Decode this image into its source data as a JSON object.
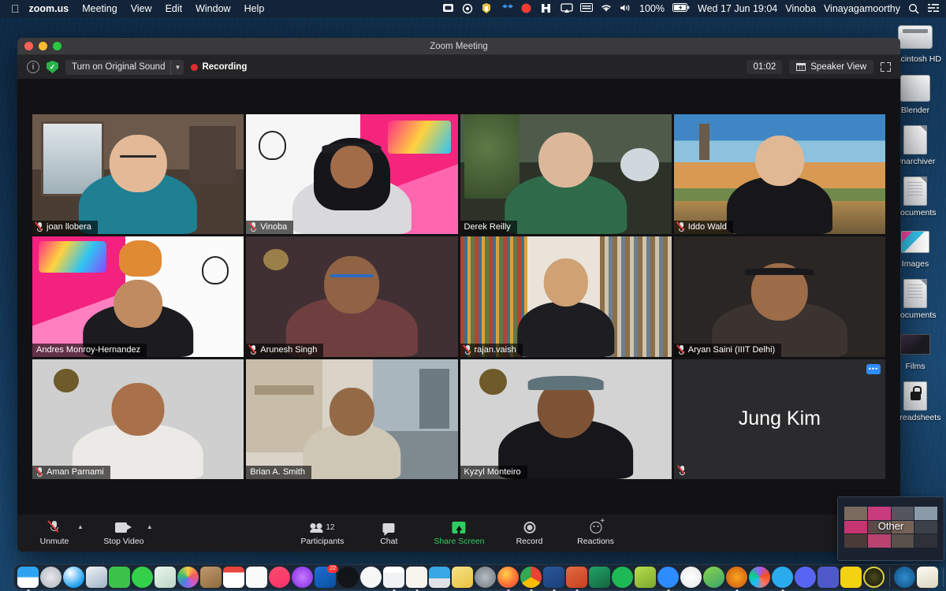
{
  "menubar": {
    "apple_icon": "apple-logo-icon",
    "items": [
      {
        "label": "zoom.us",
        "bold": true
      },
      {
        "label": "Meeting",
        "bold": false
      },
      {
        "label": "View",
        "bold": false
      },
      {
        "label": "Edit",
        "bold": false
      },
      {
        "label": "Window",
        "bold": false
      },
      {
        "label": "Help",
        "bold": false
      }
    ],
    "status_icons": [
      "screen-recording-icon",
      "circle-slash-icon",
      "shield-badge-icon",
      "dropbox-icon",
      "record-red-icon",
      "bartender-icon",
      "airplay-icon",
      "keyboard-icon",
      "wifi-icon",
      "volume-icon"
    ],
    "battery_percent": "100%",
    "battery_icon": "battery-charging-icon",
    "datetime": "Wed 17 Jun  19:04",
    "user_first": "Vinoba",
    "user_last": "Vinayagamoorthy",
    "search_icon": "search-icon",
    "control_center_icon": "control-center-icon"
  },
  "desktop_icons": [
    {
      "label": "Macintosh HD",
      "icon": "hard-drive-icon",
      "shape": "hd"
    },
    {
      "label": "Blender",
      "icon": "blender-folder-icon",
      "shape": "box"
    },
    {
      "label": "Unarchiver",
      "icon": "unarchiver-doc-icon",
      "shape": "doc-plain"
    },
    {
      "label": "Documents",
      "icon": "text-document-icon",
      "shape": "doc-lines"
    },
    {
      "label": "Images",
      "icon": "image-file-icon",
      "shape": "pic"
    },
    {
      "label": "Documents",
      "icon": "documents-stack-icon",
      "shape": "doc-lines"
    },
    {
      "label": "Films",
      "icon": "film-file-icon",
      "shape": "film"
    },
    {
      "label": "Spreadsheets",
      "icon": "locked-spreadsheet-icon",
      "shape": "lock"
    }
  ],
  "window": {
    "title": "Zoom Meeting",
    "traffic_lights": [
      "close-button",
      "minimize-button",
      "maximize-button"
    ],
    "toolbar": {
      "info_icon": "info-icon",
      "encryption_icon": "shield-check-icon",
      "original_sound_label": "Turn on Original Sound",
      "dropdown_icon": "chevron-down-icon",
      "recording_label": "Recording",
      "recording_dot": "record-indicator-icon",
      "timer": "01:02",
      "view_label": "Speaker View",
      "view_icon": "grid-view-icon",
      "fullscreen_icon": "enter-fullscreen-icon"
    }
  },
  "participants": [
    {
      "name": "joan llobera",
      "muted": true,
      "active": false,
      "scene": "room-window",
      "name_visible": true
    },
    {
      "name": "Vinoba",
      "muted": true,
      "active": false,
      "scene": "lmx-slide-mirrored",
      "name_visible": true
    },
    {
      "name": "Derek Reilly",
      "muted": false,
      "active": false,
      "scene": "plant-room",
      "name_visible": true
    },
    {
      "name": "Iddo Wald",
      "muted": true,
      "active": false,
      "scene": "barcelona-sunset",
      "name_visible": true
    },
    {
      "name": "Andres Monroy-Hernandez",
      "muted": false,
      "active": true,
      "scene": "lmx-slide-cat",
      "name_visible": true
    },
    {
      "name": "Arunesh Singh",
      "muted": true,
      "active": false,
      "scene": "weave-bg-dark",
      "name_visible": true
    },
    {
      "name": "rajan.vaish",
      "muted": true,
      "active": false,
      "scene": "bookshelf",
      "name_visible": true
    },
    {
      "name": "Aryan Saini (IIIT Delhi)",
      "muted": true,
      "active": false,
      "scene": "dark-room",
      "name_visible": true
    },
    {
      "name": "Aman Parnami",
      "muted": true,
      "active": false,
      "scene": "weave-bg-light",
      "name_visible": true
    },
    {
      "name": "Brian A. Smith",
      "muted": false,
      "active": false,
      "scene": "office-window",
      "name_visible": true
    },
    {
      "name": "Kyzyl Monteiro",
      "muted": false,
      "active": false,
      "scene": "weave-bg-cap",
      "name_visible": true
    },
    {
      "name": "Jung Kim",
      "muted": true,
      "active": false,
      "scene": "name-only",
      "name_visible": false,
      "display_name": "Jung Kim",
      "more_icon": "more-options-icon"
    }
  ],
  "meeting_toolbar": {
    "mute": {
      "label": "Unmute",
      "icon": "microphone-muted-icon",
      "chevron": "chevron-up-icon"
    },
    "video": {
      "label": "Stop Video",
      "icon": "camera-icon",
      "chevron": "chevron-up-icon"
    },
    "center": [
      {
        "label": "Participants",
        "icon": "participants-icon",
        "count": "12"
      },
      {
        "label": "Chat",
        "icon": "chat-bubble-icon"
      },
      {
        "label": "Share Screen",
        "icon": "share-screen-icon",
        "accent": "#2fcb60"
      },
      {
        "label": "Record",
        "icon": "record-circle-icon"
      },
      {
        "label": "Reactions",
        "icon": "reactions-smiley-icon"
      }
    ]
  },
  "pip": {
    "label": "Other",
    "name": "screen-share-preview"
  },
  "dock": {
    "apps": [
      {
        "name": "finder",
        "color": "#3b9ae1",
        "shape": "sq",
        "running": true
      },
      {
        "name": "launchpad",
        "color": "#b9bec4",
        "shape": "ci",
        "running": false
      },
      {
        "name": "safari",
        "color": "#1f9ff0",
        "shape": "ci",
        "running": false
      },
      {
        "name": "preview",
        "color": "#e8ecef",
        "shape": "sq",
        "running": false
      },
      {
        "name": "facetime",
        "color": "#3cc24a",
        "shape": "sq",
        "running": false
      },
      {
        "name": "messages",
        "color": "#35d04a",
        "shape": "ci",
        "running": false
      },
      {
        "name": "maps",
        "color": "#e7eef2",
        "shape": "sq",
        "running": false
      },
      {
        "name": "photos",
        "color": "#f6f7f8",
        "shape": "ci",
        "running": false
      },
      {
        "name": "contacts",
        "color": "#a87c4f",
        "shape": "sq",
        "running": false
      },
      {
        "name": "calendar",
        "color": "#ffffff",
        "shape": "sq",
        "running": false
      },
      {
        "name": "reminders",
        "color": "#fafafa",
        "shape": "sq",
        "running": false
      },
      {
        "name": "music",
        "color": "#fb3a5c",
        "shape": "ci",
        "running": false
      },
      {
        "name": "podcasts",
        "color": "#9b4dff",
        "shape": "ci",
        "running": false
      },
      {
        "name": "outlook",
        "color": "#1b6fd4",
        "shape": "sq",
        "running": false,
        "badge": "22"
      },
      {
        "name": "appletv",
        "color": "#111418",
        "shape": "ci",
        "running": false
      },
      {
        "name": "news",
        "color": "#f7f7f7",
        "shape": "ci",
        "running": false
      },
      {
        "name": "numbers",
        "color": "#f2f3f5",
        "shape": "sq",
        "running": false
      },
      {
        "name": "pages",
        "color": "#f7f5ee",
        "shape": "sq",
        "running": true
      },
      {
        "name": "keynote",
        "color": "#38a7e3",
        "shape": "sq",
        "running": false
      },
      {
        "name": "stickies",
        "color": "#f0d463",
        "shape": "sq",
        "running": false
      },
      {
        "name": "system-preferences",
        "color": "#8e949b",
        "shape": "ci",
        "running": false
      },
      {
        "name": "firefox",
        "color": "#ff7139",
        "shape": "ci",
        "running": true
      },
      {
        "name": "chrome",
        "color": "#4285f4",
        "shape": "ci",
        "running": true
      },
      {
        "name": "word",
        "color": "#2b579a",
        "shape": "sq",
        "running": true
      },
      {
        "name": "powerpoint",
        "color": "#d24726",
        "shape": "sq",
        "running": true
      },
      {
        "name": "excel",
        "color": "#1d7044",
        "shape": "sq",
        "running": false
      },
      {
        "name": "spotify",
        "color": "#1db954",
        "shape": "ci",
        "running": false
      },
      {
        "name": "mendeley",
        "color": "#a4c93b",
        "shape": "sq",
        "running": false
      },
      {
        "name": "zoom",
        "color": "#2d8cff",
        "shape": "ci",
        "running": true
      },
      {
        "name": "slack",
        "color": "#efefef",
        "shape": "ci",
        "running": false
      },
      {
        "name": "miro",
        "color": "#f5d03c",
        "shape": "ci",
        "running": false
      },
      {
        "name": "blender",
        "color": "#e87d0d",
        "shape": "ci",
        "running": true
      },
      {
        "name": "figma",
        "color": "#ffffff",
        "shape": "ci",
        "running": false
      },
      {
        "name": "telegram",
        "color": "#2aabee",
        "shape": "ci",
        "running": true
      },
      {
        "name": "discord",
        "color": "#5865f2",
        "shape": "ci",
        "running": false
      },
      {
        "name": "teams",
        "color": "#5059c9",
        "shape": "sq",
        "running": false
      },
      {
        "name": "m-app",
        "color": "#f5d211",
        "shape": "sq",
        "running": false
      },
      {
        "name": "dark-globe",
        "color": "#2c2c16",
        "shape": "ci",
        "running": false
      }
    ],
    "recent": [
      {
        "name": "quicklook",
        "color": "#1d6fa5",
        "shape": "ci"
      },
      {
        "name": "textedit",
        "color": "#f4f2e6",
        "shape": "sq"
      }
    ],
    "minimized": [
      {
        "name": "finder-window-preview",
        "color": "#7aa27c"
      },
      {
        "name": "zoom-window-preview-1",
        "color": "#2a3140"
      },
      {
        "name": "zoom-window-preview-2",
        "color": "#2a3140"
      }
    ],
    "trash": {
      "name": "trash-icon",
      "color": "#c7ccd1"
    }
  }
}
